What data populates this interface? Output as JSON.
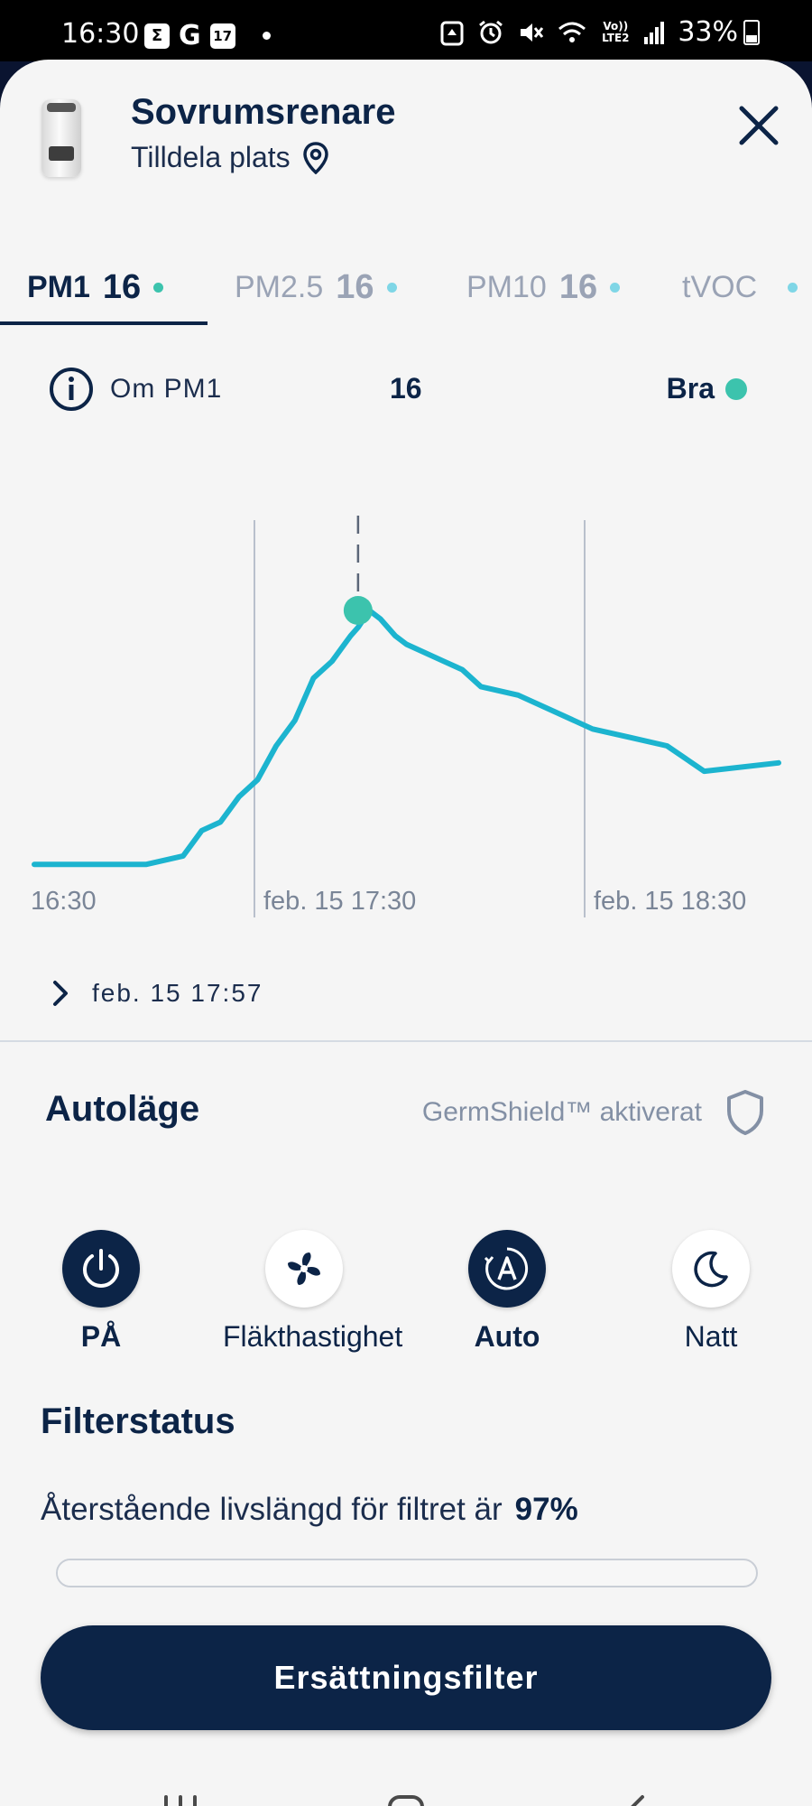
{
  "status_bar": {
    "time": "16:30",
    "left_icons": [
      "sigma-icon",
      "google-icon",
      "calendar-icon",
      "dot-icon"
    ],
    "calendar_day": "17",
    "right_icons": [
      "recycle-icon",
      "alarm-icon",
      "mute-icon",
      "wifi-icon",
      "volte-icon",
      "signal-icon",
      "battery-icon"
    ],
    "volte_label": "Vo)) LTE2",
    "battery": "33%"
  },
  "header": {
    "device_name": "Sovrumsrenare",
    "location_label": "Tilldela plats"
  },
  "tabs": [
    {
      "label": "PM1",
      "value": "16",
      "active": true
    },
    {
      "label": "PM2.5",
      "value": "16",
      "active": false
    },
    {
      "label": "PM10",
      "value": "16",
      "active": false
    },
    {
      "label": "tVOC",
      "value": "",
      "active": false
    }
  ],
  "info": {
    "label": "Om PM1",
    "value": "16",
    "status": "Bra",
    "status_color": "#3cc3ad"
  },
  "chart_data": {
    "type": "line",
    "x_tick_labels": [
      "16:30",
      "feb. 15 17:30",
      "feb. 15 18:30"
    ],
    "series": [
      {
        "color": "#1cb4cf",
        "x_minutes_from_1630": [
          0,
          30,
          40,
          45,
          50,
          55,
          60,
          65,
          70,
          75,
          80,
          85,
          87,
          90,
          93,
          97,
          100,
          110,
          115,
          120,
          130,
          140,
          150,
          160,
          170,
          180,
          200
        ],
        "values": [
          1,
          1,
          1.5,
          3,
          3.5,
          5,
          6,
          8,
          9.5,
          12,
          13,
          14.5,
          15,
          16,
          15.5,
          14.5,
          14,
          13,
          12.5,
          11.5,
          11,
          10,
          9,
          8.5,
          8,
          6.5,
          7
        ]
      }
    ],
    "highlight": {
      "time": "17:57",
      "value": 16
    },
    "grid_vertical": true
  },
  "selected_time": "feb. 15 17:57",
  "mode": {
    "title": "Autoläge",
    "germshield": "GermShield™ aktiverat"
  },
  "controls": [
    {
      "label": "PÅ",
      "icon": "power-icon",
      "active": true
    },
    {
      "label": "Fläkthastighet",
      "icon": "fan-icon",
      "active": false
    },
    {
      "label": "Auto",
      "icon": "auto-icon",
      "active": true
    },
    {
      "label": "Natt",
      "icon": "moon-icon",
      "active": false
    }
  ],
  "filter": {
    "title": "Filterstatus",
    "text": "Återstående livslängd för filtret är",
    "percent": "97%",
    "remaining_fraction": 0.97
  },
  "replace_button": "Ersättningsfilter",
  "colors": {
    "navy": "#0c2447",
    "teal": "#3cc3ad",
    "line": "#1cb4cf"
  }
}
